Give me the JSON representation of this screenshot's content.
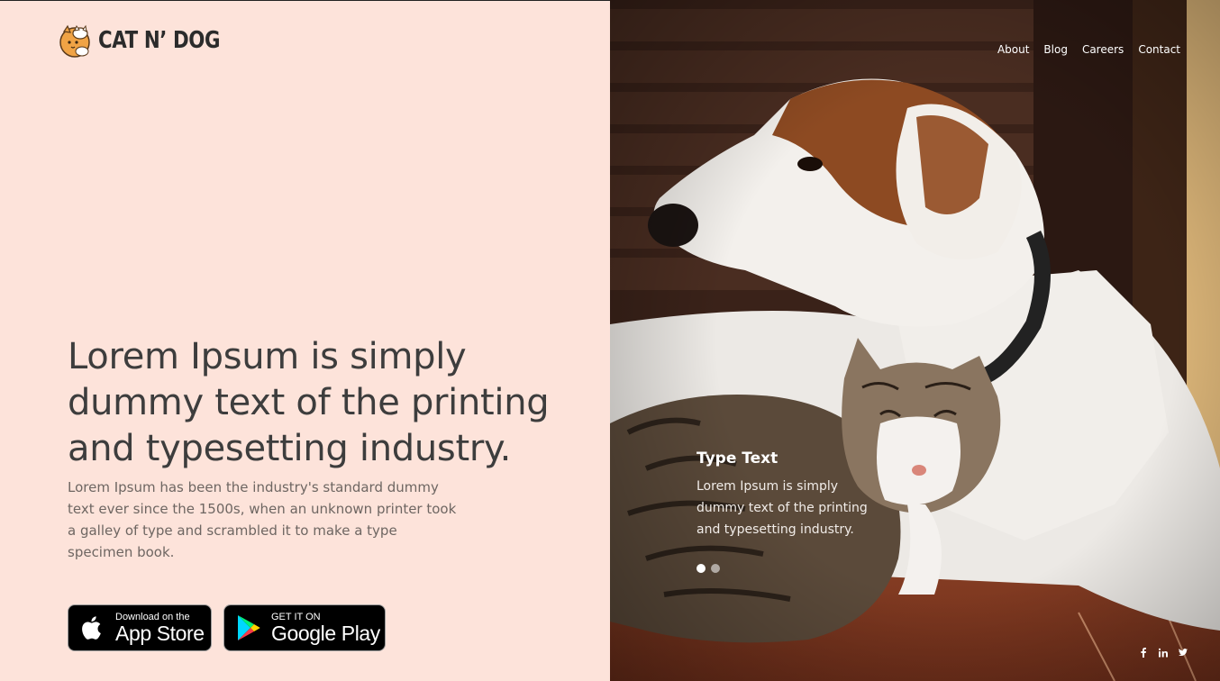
{
  "brand": {
    "name": "CAT N’ DOG"
  },
  "nav": {
    "items": [
      "About",
      "Blog",
      "Careers",
      "Contact"
    ]
  },
  "hero": {
    "headline": "Lorem Ipsum is simply dummy text of the printing and typesetting industry.",
    "body": "Lorem Ipsum has been the industry's standard dummy text ever since the 1500s, when an unknown printer took a galley of type and scrambled it to make a type specimen book."
  },
  "stores": {
    "appstore": {
      "small": "Download on the",
      "big": "App Store"
    },
    "googleplay": {
      "small": "GET IT ON",
      "big": "Google Play"
    }
  },
  "slide": {
    "title": "Type Text",
    "text": "Lorem Ipsum is simply dummy text of the printing and typesetting industry.",
    "active_index": 1,
    "total": 2
  },
  "social": {
    "icons": [
      "facebook-icon",
      "linkedin-icon",
      "twitter-icon"
    ]
  },
  "colors": {
    "left_bg": "#fde3da",
    "headline": "#3d3d3d",
    "body": "#6e6662"
  }
}
